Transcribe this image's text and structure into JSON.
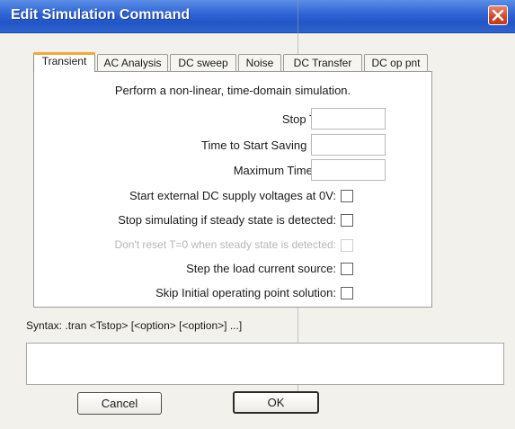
{
  "window": {
    "title": "Edit Simulation Command"
  },
  "tabs": [
    {
      "label": "Transient"
    },
    {
      "label": "AC Analysis"
    },
    {
      "label": "DC sweep"
    },
    {
      "label": "Noise"
    },
    {
      "label": "DC Transfer"
    },
    {
      "label": "DC op pnt"
    }
  ],
  "panel": {
    "headline": "Perform a non-linear, time-domain simulation.",
    "fields": [
      {
        "label": "Stop Time:",
        "value": ""
      },
      {
        "label": "Time to Start Saving Data:",
        "value": ""
      },
      {
        "label": "Maximum Timestep:",
        "value": ""
      }
    ],
    "checkboxes": [
      {
        "label": "Start external DC supply voltages at 0V:",
        "checked": false
      },
      {
        "label": "Stop simulating if steady state is detected:",
        "checked": false
      },
      {
        "label": "Don't reset T=0 when steady state is detected:",
        "checked": false
      },
      {
        "label": "Step the load current source:",
        "checked": false
      },
      {
        "label": "Skip Initial operating point solution:",
        "checked": false
      }
    ]
  },
  "syntax": {
    "text": "Syntax:  .tran <Tstop> [<option> [<option>] ...]",
    "value": ""
  },
  "buttons": {
    "cancel": "Cancel",
    "ok": "OK"
  },
  "colors": {
    "title_bar": "#2e63d3",
    "close_button": "#d1462a",
    "active_tab_accent": "#f0a93a"
  }
}
